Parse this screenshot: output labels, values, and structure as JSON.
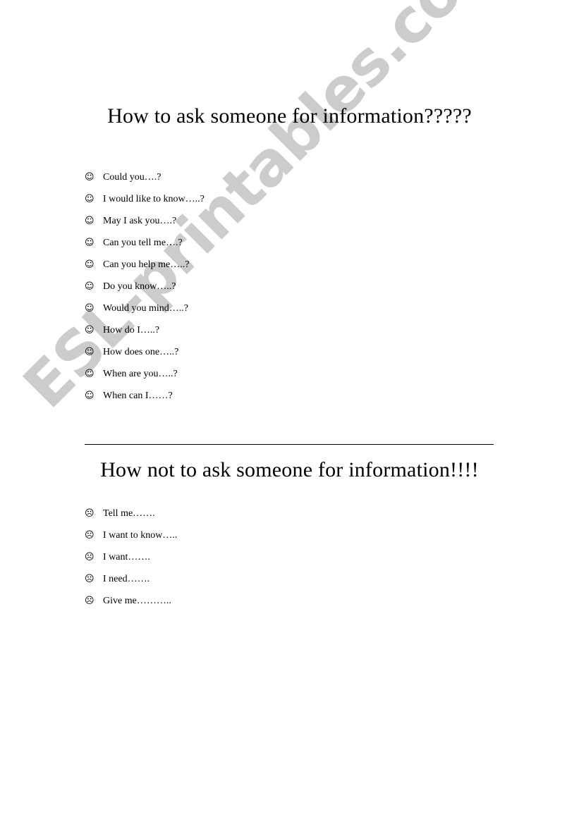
{
  "document": {
    "background_color": "#ffffff",
    "text_color": "#000000"
  },
  "watermark": {
    "text": "ESL-printables.com",
    "color": "#cccccc",
    "rotation_deg": -45
  },
  "sections": {
    "polite": {
      "title": "How to ask someone for information?????",
      "bullet_icon": "smiling-face-icon",
      "bullet_glyph": "☺",
      "items": [
        "Could you….?",
        "I would like to know…..?",
        "May I ask you….?",
        "Can you tell me….?",
        "Can you help me…..?",
        "Do you know…..?",
        "Would you mind…..?",
        "How do I…..?",
        "How does one…..?",
        "When are you…..?",
        "When can I……?"
      ]
    },
    "impolite": {
      "title": "How not to ask someone for information!!!!",
      "bullet_icon": "frowning-face-icon",
      "bullet_glyph": "☹",
      "items": [
        "Tell me…….",
        "I want to know…..",
        "I want…….",
        "I need…….",
        "Give me……….."
      ]
    }
  }
}
